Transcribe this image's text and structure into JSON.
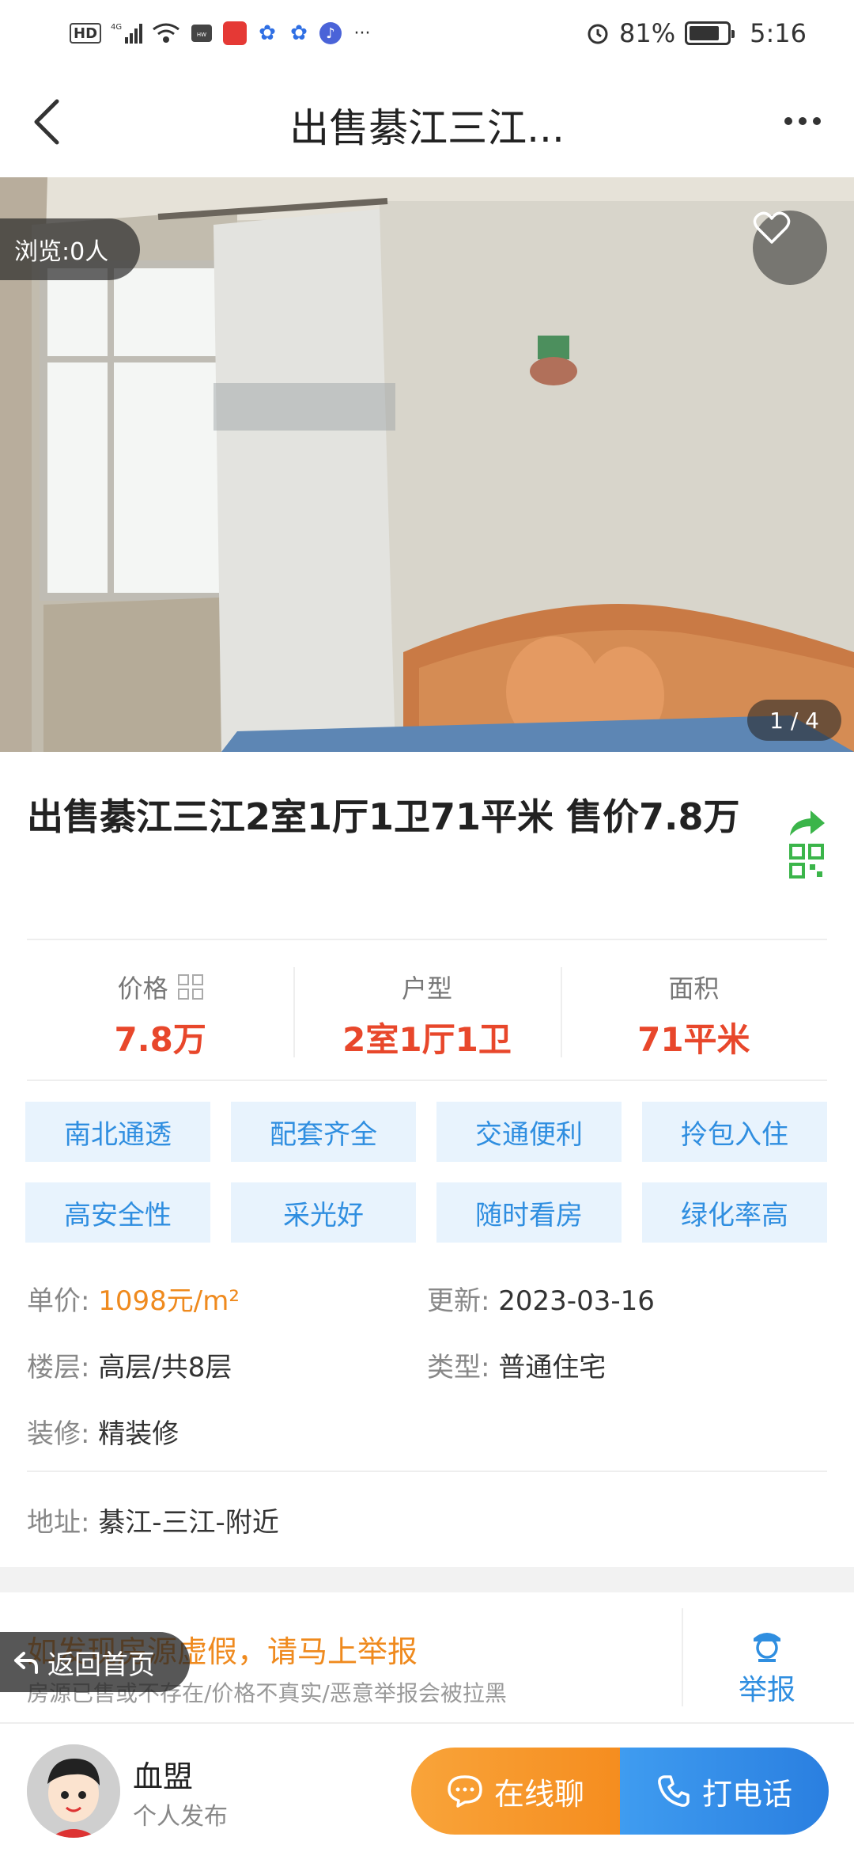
{
  "status_bar": {
    "hd": "HD",
    "network": "4G",
    "battery_pct": "81%",
    "battery_level": 0.81,
    "time": "5:16",
    "more": "···"
  },
  "nav": {
    "title": "出售綦江三江..."
  },
  "photo": {
    "views": "浏览:0人",
    "counter": "1 / 4"
  },
  "listing": {
    "title": "出售綦江三江2室1厅1卫71平米 售价7.8万"
  },
  "stats": [
    {
      "label": "价格",
      "value": "7.8万"
    },
    {
      "label": "户型",
      "value": "2室1厅1卫"
    },
    {
      "label": "面积",
      "value": "71平米"
    }
  ],
  "tags": [
    "南北通透",
    "配套齐全",
    "交通便利",
    "拎包入住",
    "高安全性",
    "采光好",
    "随时看房",
    "绿化率高"
  ],
  "details": {
    "unit_price_key": "单价:",
    "unit_price_val": "1098元/m²",
    "updated_key": "更新:",
    "updated_val": "2023-03-16",
    "floor_key": "楼层:",
    "floor_val": "高层/共8层",
    "type_key": "类型:",
    "type_val": "普通住宅",
    "decor_key": "装修:",
    "decor_val": "精装修",
    "address_key": "地址:",
    "address_val": "綦江-三江-附近"
  },
  "report": {
    "title": "如发现房源虚假，请马上举报",
    "subtitle": "房源已售或不存在/价格不真实/恶意举报会被拉黑",
    "button": "举报",
    "home": "返回首页"
  },
  "seller": {
    "name": "血盟",
    "type": "个人发布"
  },
  "cta": {
    "chat": "在线聊",
    "call": "打电话"
  },
  "colors": {
    "accent_red": "#e8472b",
    "accent_orange": "#ef8a1e",
    "accent_blue": "#2f8ee0",
    "share_green": "#3bb54a"
  }
}
